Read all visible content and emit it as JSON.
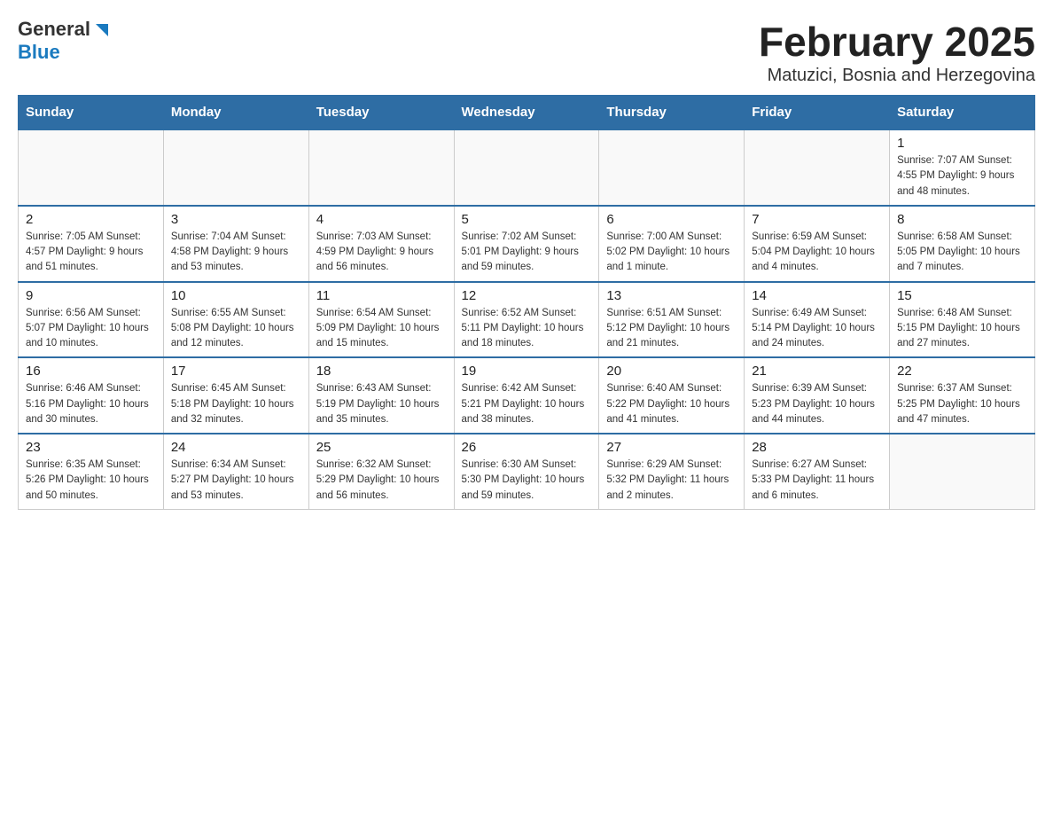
{
  "header": {
    "logo_general": "General",
    "logo_blue": "Blue",
    "month_title": "February 2025",
    "location": "Matuzici, Bosnia and Herzegovina"
  },
  "weekdays": [
    "Sunday",
    "Monday",
    "Tuesday",
    "Wednesday",
    "Thursday",
    "Friday",
    "Saturday"
  ],
  "weeks": [
    [
      {
        "day": "",
        "info": ""
      },
      {
        "day": "",
        "info": ""
      },
      {
        "day": "",
        "info": ""
      },
      {
        "day": "",
        "info": ""
      },
      {
        "day": "",
        "info": ""
      },
      {
        "day": "",
        "info": ""
      },
      {
        "day": "1",
        "info": "Sunrise: 7:07 AM\nSunset: 4:55 PM\nDaylight: 9 hours\nand 48 minutes."
      }
    ],
    [
      {
        "day": "2",
        "info": "Sunrise: 7:05 AM\nSunset: 4:57 PM\nDaylight: 9 hours\nand 51 minutes."
      },
      {
        "day": "3",
        "info": "Sunrise: 7:04 AM\nSunset: 4:58 PM\nDaylight: 9 hours\nand 53 minutes."
      },
      {
        "day": "4",
        "info": "Sunrise: 7:03 AM\nSunset: 4:59 PM\nDaylight: 9 hours\nand 56 minutes."
      },
      {
        "day": "5",
        "info": "Sunrise: 7:02 AM\nSunset: 5:01 PM\nDaylight: 9 hours\nand 59 minutes."
      },
      {
        "day": "6",
        "info": "Sunrise: 7:00 AM\nSunset: 5:02 PM\nDaylight: 10 hours\nand 1 minute."
      },
      {
        "day": "7",
        "info": "Sunrise: 6:59 AM\nSunset: 5:04 PM\nDaylight: 10 hours\nand 4 minutes."
      },
      {
        "day": "8",
        "info": "Sunrise: 6:58 AM\nSunset: 5:05 PM\nDaylight: 10 hours\nand 7 minutes."
      }
    ],
    [
      {
        "day": "9",
        "info": "Sunrise: 6:56 AM\nSunset: 5:07 PM\nDaylight: 10 hours\nand 10 minutes."
      },
      {
        "day": "10",
        "info": "Sunrise: 6:55 AM\nSunset: 5:08 PM\nDaylight: 10 hours\nand 12 minutes."
      },
      {
        "day": "11",
        "info": "Sunrise: 6:54 AM\nSunset: 5:09 PM\nDaylight: 10 hours\nand 15 minutes."
      },
      {
        "day": "12",
        "info": "Sunrise: 6:52 AM\nSunset: 5:11 PM\nDaylight: 10 hours\nand 18 minutes."
      },
      {
        "day": "13",
        "info": "Sunrise: 6:51 AM\nSunset: 5:12 PM\nDaylight: 10 hours\nand 21 minutes."
      },
      {
        "day": "14",
        "info": "Sunrise: 6:49 AM\nSunset: 5:14 PM\nDaylight: 10 hours\nand 24 minutes."
      },
      {
        "day": "15",
        "info": "Sunrise: 6:48 AM\nSunset: 5:15 PM\nDaylight: 10 hours\nand 27 minutes."
      }
    ],
    [
      {
        "day": "16",
        "info": "Sunrise: 6:46 AM\nSunset: 5:16 PM\nDaylight: 10 hours\nand 30 minutes."
      },
      {
        "day": "17",
        "info": "Sunrise: 6:45 AM\nSunset: 5:18 PM\nDaylight: 10 hours\nand 32 minutes."
      },
      {
        "day": "18",
        "info": "Sunrise: 6:43 AM\nSunset: 5:19 PM\nDaylight: 10 hours\nand 35 minutes."
      },
      {
        "day": "19",
        "info": "Sunrise: 6:42 AM\nSunset: 5:21 PM\nDaylight: 10 hours\nand 38 minutes."
      },
      {
        "day": "20",
        "info": "Sunrise: 6:40 AM\nSunset: 5:22 PM\nDaylight: 10 hours\nand 41 minutes."
      },
      {
        "day": "21",
        "info": "Sunrise: 6:39 AM\nSunset: 5:23 PM\nDaylight: 10 hours\nand 44 minutes."
      },
      {
        "day": "22",
        "info": "Sunrise: 6:37 AM\nSunset: 5:25 PM\nDaylight: 10 hours\nand 47 minutes."
      }
    ],
    [
      {
        "day": "23",
        "info": "Sunrise: 6:35 AM\nSunset: 5:26 PM\nDaylight: 10 hours\nand 50 minutes."
      },
      {
        "day": "24",
        "info": "Sunrise: 6:34 AM\nSunset: 5:27 PM\nDaylight: 10 hours\nand 53 minutes."
      },
      {
        "day": "25",
        "info": "Sunrise: 6:32 AM\nSunset: 5:29 PM\nDaylight: 10 hours\nand 56 minutes."
      },
      {
        "day": "26",
        "info": "Sunrise: 6:30 AM\nSunset: 5:30 PM\nDaylight: 10 hours\nand 59 minutes."
      },
      {
        "day": "27",
        "info": "Sunrise: 6:29 AM\nSunset: 5:32 PM\nDaylight: 11 hours\nand 2 minutes."
      },
      {
        "day": "28",
        "info": "Sunrise: 6:27 AM\nSunset: 5:33 PM\nDaylight: 11 hours\nand 6 minutes."
      },
      {
        "day": "",
        "info": ""
      }
    ]
  ]
}
